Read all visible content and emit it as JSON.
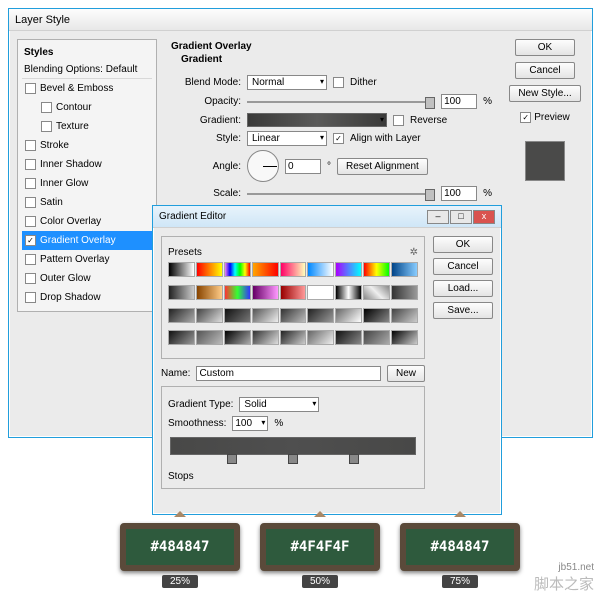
{
  "main": {
    "title": "Layer Style"
  },
  "styles": {
    "header": "Styles",
    "blending": "Blending Options: Default",
    "items": [
      "Bevel & Emboss",
      "Contour",
      "Texture",
      "Stroke",
      "Inner Shadow",
      "Inner Glow",
      "Satin",
      "Color Overlay",
      "Gradient Overlay",
      "Pattern Overlay",
      "Outer Glow",
      "Drop Shadow"
    ],
    "indent": [
      1,
      2
    ],
    "checked": [
      8
    ],
    "selected": 8
  },
  "go": {
    "title": "Gradient Overlay",
    "sub": "Gradient",
    "blendmode_l": "Blend Mode:",
    "blendmode": "Normal",
    "dither": "Dither",
    "opacity_l": "Opacity:",
    "opacity": "100",
    "pct": "%",
    "gradient_l": "Gradient:",
    "reverse": "Reverse",
    "style_l": "Style:",
    "style": "Linear",
    "align": "Align with Layer",
    "angle_l": "Angle:",
    "angle": "0",
    "deg": "°",
    "reset": "Reset Alignment",
    "scale_l": "Scale:",
    "scale": "100"
  },
  "buttons": {
    "ok": "OK",
    "cancel": "Cancel",
    "newstyle": "New Style...",
    "preview": "Preview"
  },
  "ge": {
    "title": "Gradient Editor",
    "presets": "Presets",
    "gear": "✲",
    "name_l": "Name:",
    "name": "Custom",
    "new": "New",
    "type_l": "Gradient Type:",
    "type": "Solid",
    "smooth_l": "Smoothness:",
    "smooth": "100",
    "pct": "%",
    "stops_l": "Stops",
    "ok": "OK",
    "cancel": "Cancel",
    "load": "Load...",
    "save": "Save...",
    "swatches": [
      "linear-gradient(90deg,#000,#fff)",
      "linear-gradient(90deg,red,yellow)",
      "linear-gradient(90deg,violet,blue,cyan,lime,yellow,red)",
      "linear-gradient(90deg,orange,red)",
      "linear-gradient(90deg,#f06,#ffb)",
      "linear-gradient(90deg,#08f,#fff)",
      "linear-gradient(90deg,#a0f,#0ff)",
      "linear-gradient(90deg,#f00,#ff0,#0f0)",
      "linear-gradient(90deg,#048,#8cf)",
      "linear-gradient(90deg,#222,#ccc)",
      "linear-gradient(90deg,#840,#fc8)",
      "linear-gradient(90deg,#f33,#3f3,#33f)",
      "linear-gradient(90deg,#606,#f9f)",
      "linear-gradient(90deg,#900,#f99)",
      "linear-gradient(90deg,#fff,#fff)",
      "linear-gradient(90deg,#000,#fff,#000)",
      "linear-gradient(45deg,#888,#eee,#888)",
      "linear-gradient(90deg,#333,#999)",
      "linear-gradient(135deg,#222,#aaa)",
      "linear-gradient(135deg,#444,#ddd)",
      "linear-gradient(135deg,#111,#777)",
      "linear-gradient(135deg,#555,#eee)",
      "linear-gradient(135deg,#333,#bbb)",
      "linear-gradient(135deg,#222,#999)",
      "linear-gradient(135deg,#666,#fff)",
      "linear-gradient(135deg,#000,#888)",
      "linear-gradient(135deg,#444,#ccc)",
      "linear-gradient(135deg,#111,#999)",
      "linear-gradient(135deg,#555,#bbb)",
      "linear-gradient(135deg,#000,#aaa)",
      "linear-gradient(135deg,#333,#ddd)",
      "linear-gradient(135deg,#222,#ccc)",
      "linear-gradient(135deg,#666,#eee)",
      "linear-gradient(135deg,#111,#888)",
      "linear-gradient(135deg,#444,#aaa)",
      "linear-gradient(135deg,#000,#ccc)"
    ]
  },
  "callouts": [
    {
      "hex": "#484847",
      "pct": "25%"
    },
    {
      "hex": "#4F4F4F",
      "pct": "50%"
    },
    {
      "hex": "#484847",
      "pct": "75%"
    }
  ],
  "footer": {
    "url": "jb51.net",
    "name": "脚本之家"
  }
}
